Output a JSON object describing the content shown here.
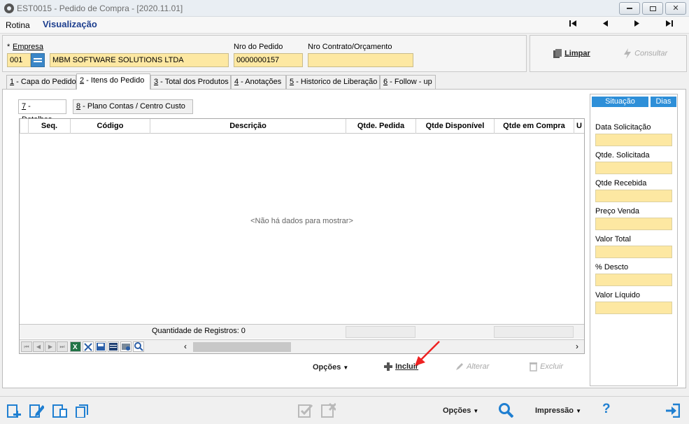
{
  "window": {
    "title": "EST0015 - Pedido de Compra - [2020.11.01]",
    "min_label": "▭",
    "max_label": "▣",
    "close_label": "✕"
  },
  "menu": {
    "rotina": "Rotina",
    "mode": "Visualização",
    "nav": [
      "⏮",
      "◀",
      "▶",
      "⏭"
    ]
  },
  "header": {
    "empresa_label": "Empresa",
    "required_mark": "*",
    "empresa_code": "001",
    "empresa_name": "MBM SOFTWARE SOLUTIONS LTDA",
    "nro_pedido_label": "Nro do Pedido",
    "nro_pedido": "0000000157",
    "nro_contrato_label": "Nro Contrato/Orçamento",
    "nro_contrato": "",
    "limpar": "Limpar",
    "consultar": "Consultar"
  },
  "tabs": [
    {
      "key": "1",
      "label": " - Capa do Pedido"
    },
    {
      "key": "2",
      "label": " - Itens do Pedido"
    },
    {
      "key": "3",
      "label": " - Total dos Produtos"
    },
    {
      "key": "4",
      "label": " - Anotações"
    },
    {
      "key": "5",
      "label": " - Historico de Liberação"
    },
    {
      "key": "6",
      "label": " - Follow - up"
    }
  ],
  "inner_tabs": [
    {
      "key": "7",
      "label": " - Detalhes"
    },
    {
      "key": "8",
      "label": " - Plano Contas / Centro Custo"
    }
  ],
  "grid": {
    "columns": [
      "Seq.",
      "Código",
      "Descrição",
      "Qtde. Pedida",
      "Qtde Disponível",
      "Qtde em Compra",
      "U"
    ],
    "empty_text": "<Não há dados para mostrar>",
    "footer_count": "Quantidade de Registros: 0"
  },
  "actions": {
    "opcoes": "Opções",
    "incluir": "Incluir",
    "alterar": "Alterar",
    "excluir": "Excluir"
  },
  "side_panel": {
    "tab_situacao": "Situação",
    "tab_dias": "Dias",
    "fields": [
      "Data Solicitação",
      "Qtde. Solicitada",
      "Qtde Recebida",
      "Preço Venda",
      "Valor Total",
      "% Descto",
      "Valor Líquido"
    ]
  },
  "bottom": {
    "opcoes": "Opções",
    "impressao": "Impressão",
    "help": "?"
  },
  "colors": {
    "field_yellow": "#fde8a2",
    "accent_blue": "#2e8fd8",
    "title_blue": "#1c3e8e"
  }
}
